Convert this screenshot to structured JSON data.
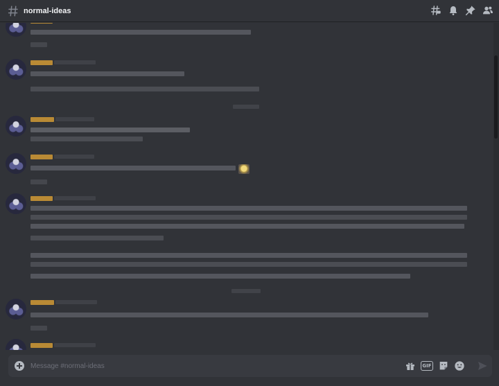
{
  "header": {
    "channel_name": "normal-ideas",
    "icons": [
      "hashtag-icon",
      "threads-icon",
      "bell-icon",
      "pin-icon",
      "members-icon"
    ]
  },
  "composer": {
    "placeholder": "Message #normal-ideas",
    "icons": [
      "add-icon",
      "gift-icon",
      "gif-icon",
      "sticker-icon",
      "emoji-icon",
      "send-icon"
    ],
    "gif_label": "GIF"
  },
  "colors": {
    "background": "#313338",
    "header_border": "#1f2023",
    "composer_bg": "#383a40",
    "username_gold": "#b98a35",
    "username_blue": "#7b83c9",
    "icon_gray": "#b5bac1"
  }
}
